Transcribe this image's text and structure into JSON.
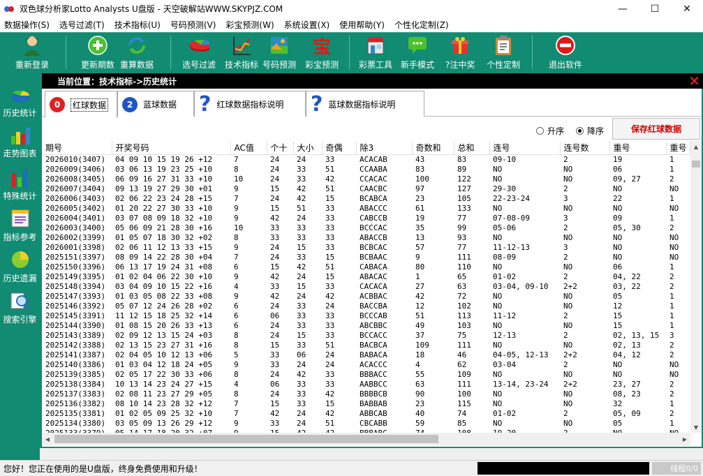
{
  "window": {
    "title": "双色球分析家Lotto Analysts U盘版 - 天空破解站WWW.SKYPJZ.COM",
    "minimize": "—",
    "maximize": "☐",
    "close": "✕"
  },
  "menu": [
    "数据操作(S)",
    "选号过滤(T)",
    "技术指标(U)",
    "号码预测(V)",
    "彩宝预测(W)",
    "系统设置(X)",
    "使用帮助(Y)",
    "个性化定制(Z)"
  ],
  "toolbar": [
    {
      "label": "重新登录",
      "icon": "user-icon"
    },
    {
      "label": "更新期数",
      "icon": "plus-icon"
    },
    {
      "label": "重算数据",
      "icon": "refresh-icon"
    },
    {
      "label": "选号过滤",
      "icon": "pie-icon"
    },
    {
      "label": "技术指标",
      "icon": "chart-icon"
    },
    {
      "label": "号码预测",
      "icon": "landscape-icon"
    },
    {
      "label": "彩宝预测",
      "icon": "bao-icon"
    },
    {
      "label": "彩票工具",
      "icon": "shop-icon"
    },
    {
      "label": "新手模式",
      "icon": "chat-icon"
    },
    {
      "label": "?注中奖",
      "icon": "gift-icon"
    },
    {
      "label": "个性定制",
      "icon": "clipboard-icon"
    },
    {
      "label": "退出软件",
      "icon": "exit-icon"
    }
  ],
  "sidebar": [
    {
      "label": "历史统计",
      "icon": "history-stats-icon"
    },
    {
      "label": "走势图表",
      "icon": "trend-chart-icon"
    },
    {
      "label": "特殊统计",
      "icon": "special-stats-icon"
    },
    {
      "label": "指标参考",
      "icon": "indicator-ref-icon"
    },
    {
      "label": "历史遗漏",
      "icon": "history-miss-icon"
    },
    {
      "label": "搜索引擎",
      "icon": "search-engine-icon"
    }
  ],
  "location": {
    "text": "当前位置：技术指标->历史统计",
    "close": "✕"
  },
  "tabs": [
    {
      "label": "红球数据",
      "ball": "0",
      "ball_color": "#e02020"
    },
    {
      "label": "蓝球数据",
      "ball": "2",
      "ball_color": "#1f56c4"
    },
    {
      "label": "红球数据指标说明",
      "q": "?"
    },
    {
      "label": "蓝球数据指标说明",
      "q": "?"
    }
  ],
  "sort": {
    "asc": "升序",
    "desc": "降序",
    "selected": "desc"
  },
  "save_button": "保存红球数据",
  "table": {
    "columns": [
      "期号",
      "开奖号码",
      "AC值",
      "个十",
      "大小",
      "奇偶",
      "除3",
      "奇数和",
      "总和",
      "连号",
      "连号数",
      "重号",
      "重号"
    ],
    "rows": [
      [
        "2026010(3407)",
        "04 09 10 15 19 26 +12",
        "7",
        "24",
        "24",
        "33",
        "ACACAB",
        "43",
        "83",
        "09-10",
        "2",
        "19",
        "1"
      ],
      [
        "2026009(3406)",
        "03 06 13 19 23 25 +10",
        "8",
        "24",
        "33",
        "51",
        "CCAABA",
        "83",
        "89",
        "NO",
        "NO",
        "06",
        "1"
      ],
      [
        "2026008(3405)",
        "06 09 16 27 31 33 +10",
        "10",
        "24",
        "33",
        "42",
        "CCACAC",
        "100",
        "122",
        "NO",
        "NO",
        "09, 27",
        "2"
      ],
      [
        "2026007(3404)",
        "09 13 19 27 29 30 +01",
        "9",
        "15",
        "42",
        "51",
        "CAACBC",
        "97",
        "127",
        "29-30",
        "2",
        "NO",
        "NO"
      ],
      [
        "2026006(3403)",
        "02 06 22 23 24 28 +15",
        "7",
        "24",
        "42",
        "15",
        "BCABCA",
        "23",
        "105",
        "22-23-24",
        "3",
        "22",
        "1"
      ],
      [
        "2026005(3402)",
        "01 20 22 27 30 33 +10",
        "9",
        "15",
        "51",
        "33",
        "ABACCC",
        "61",
        "133",
        "NO",
        "NO",
        "NO",
        "NO"
      ],
      [
        "2026004(3401)",
        "03 07 08 09 18 32 +10",
        "9",
        "42",
        "24",
        "33",
        "CABCCB",
        "19",
        "77",
        "07-08-09",
        "3",
        "09",
        "1"
      ],
      [
        "2026003(3400)",
        "05 06 09 21 28 30 +16",
        "10",
        "33",
        "33",
        "33",
        "BCCCAC",
        "35",
        "99",
        "05-06",
        "2",
        "05, 30",
        "2"
      ],
      [
        "2026002(3399)",
        "01 05 07 18 30 32 +02",
        "8",
        "33",
        "33",
        "33",
        "ABACCB",
        "13",
        "93",
        "NO",
        "NO",
        "NO",
        "NO"
      ],
      [
        "2026001(3398)",
        "02 06 11 12 13 33 +15",
        "9",
        "24",
        "15",
        "33",
        "BCBCAC",
        "57",
        "77",
        "11-12-13",
        "3",
        "NO",
        "NO"
      ],
      [
        "2025151(3397)",
        "08 09 14 22 28 30 +04",
        "7",
        "24",
        "33",
        "15",
        "BCBAAC",
        "9",
        "111",
        "08-09",
        "2",
        "NO",
        "NO"
      ],
      [
        "2025150(3396)",
        "06 13 17 19 24 31 +08",
        "6",
        "15",
        "42",
        "51",
        "CABACA",
        "80",
        "110",
        "NO",
        "NO",
        "06",
        "1"
      ],
      [
        "2025149(3395)",
        "01 02 04 06 22 30 +10",
        "9",
        "42",
        "24",
        "15",
        "ABACAC",
        "1",
        "65",
        "01-02",
        "2",
        "04, 22",
        "2"
      ],
      [
        "2025148(3394)",
        "03 04 09 10 15 22 +16",
        "4",
        "33",
        "15",
        "33",
        "CACACA",
        "27",
        "63",
        "03-04, 09-10",
        "2+2",
        "03, 22",
        "2"
      ],
      [
        "2025147(3393)",
        "01 03 05 08 22 33 +08",
        "9",
        "42",
        "24",
        "42",
        "ACBBAC",
        "42",
        "72",
        "NO",
        "NO",
        "05",
        "1"
      ],
      [
        "2025146(3392)",
        "05 07 12 24 26 28 +02",
        "6",
        "24",
        "33",
        "24",
        "BACCBA",
        "12",
        "102",
        "NO",
        "NO",
        "12",
        "1"
      ],
      [
        "2025145(3391)",
        "11 12 15 18 25 32 +14",
        "6",
        "06",
        "33",
        "33",
        "BCCCAB",
        "51",
        "113",
        "11-12",
        "2",
        "15",
        "1"
      ],
      [
        "2025144(3390)",
        "01 08 15 20 26 33 +13",
        "6",
        "24",
        "33",
        "33",
        "ABCBBC",
        "49",
        "103",
        "NO",
        "NO",
        "15",
        "1"
      ],
      [
        "2025143(3389)",
        "02 09 12 13 15 24 +03",
        "8",
        "24",
        "15",
        "33",
        "BCCACC",
        "37",
        "75",
        "12-13",
        "2",
        "02, 13, 15",
        "3"
      ],
      [
        "2025142(3388)",
        "02 13 15 23 27 31 +16",
        "8",
        "15",
        "33",
        "51",
        "BACBCA",
        "109",
        "111",
        "NO",
        "NO",
        "02, 13",
        "2"
      ],
      [
        "2025141(3387)",
        "02 04 05 10 12 13 +06",
        "5",
        "33",
        "06",
        "24",
        "BABACA",
        "18",
        "46",
        "04-05, 12-13",
        "2+2",
        "04, 12",
        "2"
      ],
      [
        "2025140(3386)",
        "01 03 04 12 18 24 +05",
        "9",
        "33",
        "24",
        "24",
        "ACACCC",
        "4",
        "62",
        "03-04",
        "2",
        "NO",
        "NO"
      ],
      [
        "2025139(3385)",
        "02 05 17 22 30 33 +06",
        "8",
        "24",
        "42",
        "33",
        "BBBACC",
        "55",
        "109",
        "NO",
        "NO",
        "NO",
        "NO"
      ],
      [
        "2025138(3384)",
        "10 13 14 23 24 27 +15",
        "4",
        "06",
        "33",
        "33",
        "AABBCC",
        "63",
        "111",
        "13-14, 23-24",
        "2+2",
        "23, 27",
        "2"
      ],
      [
        "2025137(3383)",
        "02 08 11 23 27 29 +05",
        "8",
        "24",
        "33",
        "42",
        "BBBBCB",
        "90",
        "100",
        "NO",
        "NO",
        "08, 23",
        "2"
      ],
      [
        "2025136(3382)",
        "08 10 14 23 28 32 +12",
        "7",
        "15",
        "33",
        "15",
        "BABBAB",
        "23",
        "115",
        "NO",
        "NO",
        "32",
        "1"
      ],
      [
        "2025135(3381)",
        "01 02 05 09 25 32 +10",
        "7",
        "42",
        "24",
        "42",
        "ABBCAB",
        "40",
        "74",
        "01-02",
        "2",
        "05, 09",
        "2"
      ],
      [
        "2025134(3380)",
        "03 05 09 13 26 29 +12",
        "9",
        "33",
        "24",
        "51",
        "CBCABB",
        "59",
        "85",
        "NO",
        "NO",
        "05",
        "1"
      ],
      [
        "2025133(3379)",
        "05 14 17 18 20 32 +07",
        "9",
        "15",
        "42",
        "42",
        "BBBABC",
        "74",
        "108",
        "19-20",
        "2",
        "NO",
        "NO"
      ]
    ]
  },
  "status": {
    "text": "您好！您正在使用的是U盘版，终身免费使用和升级！",
    "progress": "线程0/0"
  }
}
